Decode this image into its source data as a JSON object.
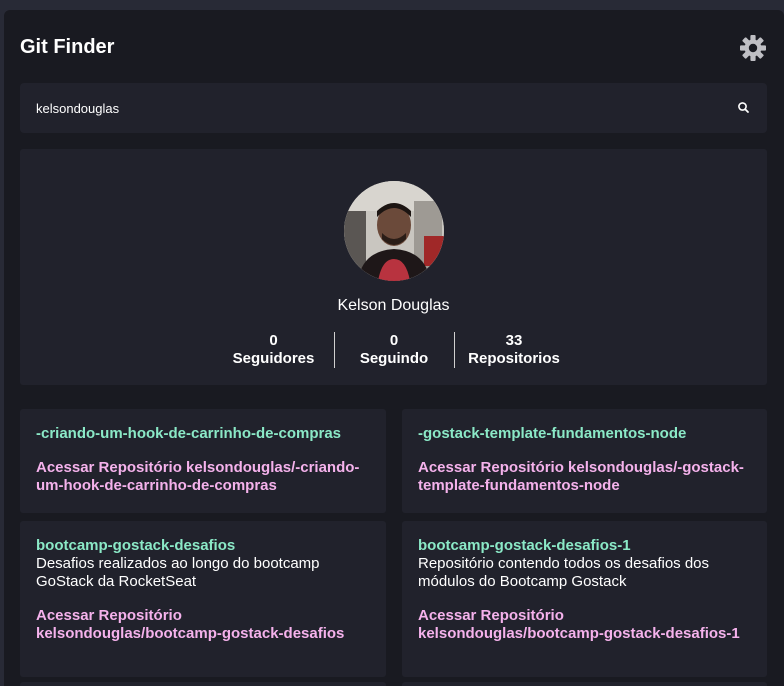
{
  "app": {
    "title": "Git Finder"
  },
  "icons": {
    "theme": "gear-icon",
    "search": "search-icon"
  },
  "colors": {
    "accent_name": "#8be9c7",
    "accent_link": "#f5b2ec",
    "panel": "#21222c",
    "background": "#191a21"
  },
  "search": {
    "value": "kelsondouglas"
  },
  "profile": {
    "name": "Kelson Douglas",
    "stats": [
      {
        "value": "0",
        "label": "Seguidores"
      },
      {
        "value": "0",
        "label": "Seguindo"
      },
      {
        "value": "33",
        "label": "Repositorios"
      }
    ]
  },
  "repos": [
    {
      "name": "-criando-um-hook-de-carrinho-de-compras",
      "description": "",
      "link": "Acessar Repositório kelsondouglas/-criando-um-hook-de-carrinho-de-compras"
    },
    {
      "name": "-gostack-template-fundamentos-node",
      "description": "",
      "link": "Acessar Repositório kelsondouglas/-gostack-template-fundamentos-node"
    },
    {
      "name": "bootcamp-gostack-desafios",
      "description": "Desafios realizados ao longo do bootcamp GoStack da RocketSeat",
      "link": "Acessar Repositório kelsondouglas/bootcamp-gostack-desafios"
    },
    {
      "name": "bootcamp-gostack-desafios-1",
      "description": "Repositório contendo todos os desafios dos módulos do Bootcamp Gostack",
      "link": "Acessar Repositório kelsondouglas/bootcamp-gostack-desafios-1"
    }
  ]
}
